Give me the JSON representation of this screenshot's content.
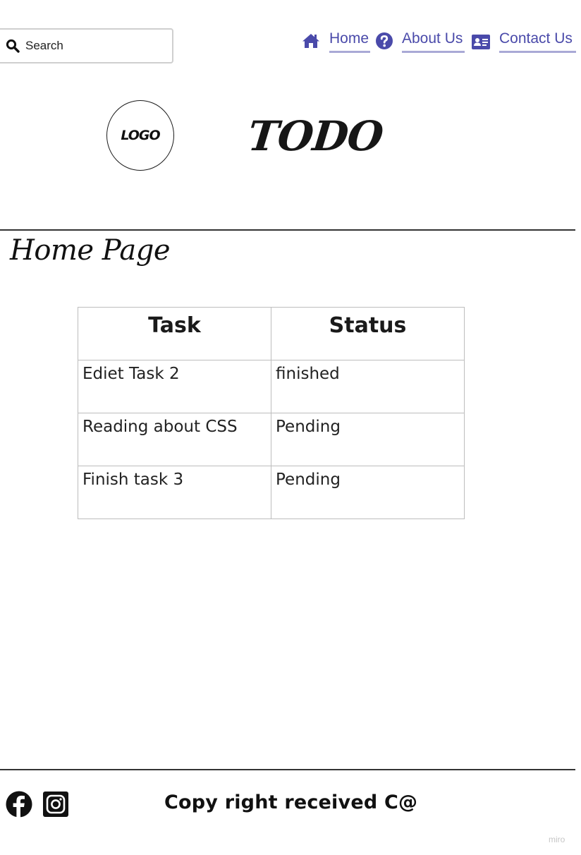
{
  "search": {
    "placeholder": "Search"
  },
  "nav": {
    "items": [
      {
        "label": "Home",
        "icon": "home-icon"
      },
      {
        "label": "About Us",
        "icon": "question-circle-icon"
      },
      {
        "label": "Contact Us",
        "icon": "id-card-icon"
      }
    ]
  },
  "header": {
    "logo_text": "LOGO",
    "brand": "TODO"
  },
  "main": {
    "page_title": "Home Page",
    "table": {
      "headers": [
        "Task",
        "Status"
      ],
      "rows": [
        [
          "Ediet Task 2",
          "finished"
        ],
        [
          "Reading about CSS",
          "Pending"
        ],
        [
          "Finish task 3",
          "Pending"
        ]
      ]
    }
  },
  "footer": {
    "social": [
      "facebook-icon",
      "instagram-icon"
    ],
    "copyright": "Copy right received C@"
  },
  "watermark": "miro",
  "colors": {
    "nav_link": "#4a4aaa",
    "nav_underline": "#a9a9d6"
  }
}
